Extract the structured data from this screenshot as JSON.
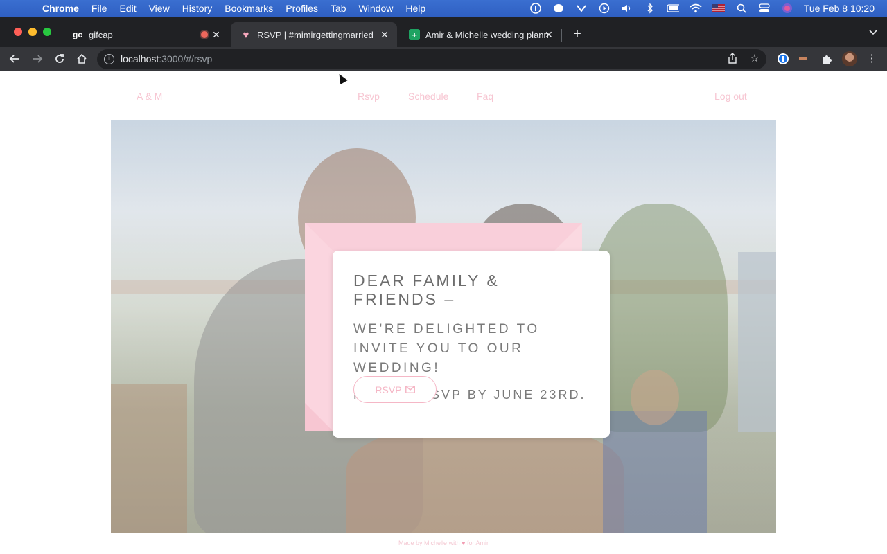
{
  "menubar": {
    "app": "Chrome",
    "items": [
      "File",
      "Edit",
      "View",
      "History",
      "Bookmarks",
      "Profiles",
      "Tab",
      "Window",
      "Help"
    ],
    "clock": "Tue Feb 8  10:20"
  },
  "tabs": [
    {
      "title": "gifcap",
      "favicon": "gc"
    },
    {
      "title": "RSVP | #mimirgettingmarried",
      "favicon": "♥"
    },
    {
      "title": "Amir & Michelle wedding plann",
      "favicon": "+"
    }
  ],
  "address": {
    "host": "localhost",
    "rest": ":3000/#/rsvp"
  },
  "site": {
    "brand": "A & M",
    "nav": [
      "Rsvp",
      "Schedule",
      "Faq"
    ],
    "logout": "Log out"
  },
  "invite": {
    "line1": "DEAR FAMILY & FRIENDS –",
    "line2": "WE'RE DELIGHTED TO INVITE YOU TO OUR WEDDING!",
    "line3": "PLEASE RSVP BY JUNE 23RD.",
    "button": "RSVP"
  },
  "footer": {
    "before": "Made by Michelle with",
    "after": "for Amir"
  },
  "colors": {
    "accent_pink": "#f5b7c6",
    "envelope": "#fbd9e1"
  }
}
